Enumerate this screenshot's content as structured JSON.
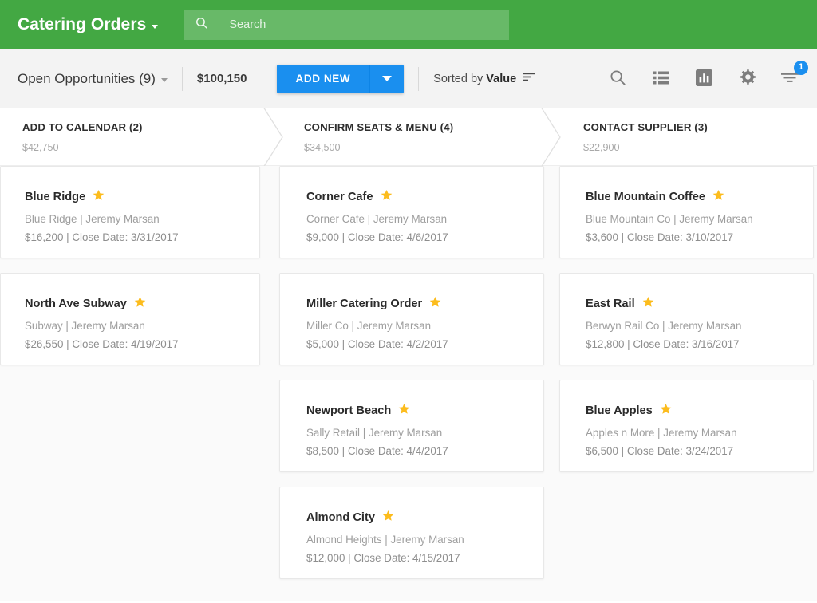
{
  "appbar": {
    "title": "Catering Orders",
    "title_caret_icon": "caret-down-icon",
    "search_icon": "search-icon",
    "search_placeholder": "Search",
    "search_value": "",
    "background_color": "#43a843"
  },
  "toolbar": {
    "scope_label": "Open Opportunities (9)",
    "scope_caret_icon": "caret-down-icon",
    "total_amount": "$100,150",
    "add_new_label": "ADD NEW",
    "add_new_caret_icon": "caret-down-icon",
    "add_new_color": "#1a8fef",
    "sorted_by_prefix": "Sorted by",
    "sorted_by_field": "Value",
    "sort_icon": "sort-descending-icon",
    "icons": [
      {
        "name": "search-icon",
        "label": "Search"
      },
      {
        "name": "list-view-icon",
        "label": "List view"
      },
      {
        "name": "chart-view-icon",
        "label": "Chart view"
      },
      {
        "name": "gear-icon",
        "label": "Settings"
      },
      {
        "name": "filter-icon",
        "label": "Filters"
      }
    ],
    "filter_badge_count": "1",
    "filter_badge_color": "#1a8fef",
    "background_color": "#f3f3f3"
  },
  "board": {
    "star_color": "#fcbc1d",
    "columns": [
      {
        "stage": "ADD TO CALENDAR (2)",
        "stage_value": "$42,750",
        "cards": [
          {
            "title": "Blue Ridge",
            "star_icon": "star-icon",
            "account": "Blue Ridge | Jeremy Marsan",
            "meta": "$16,200 | Close Date: 3/31/2017"
          },
          {
            "title": "North Ave Subway",
            "star_icon": "star-icon",
            "account": "Subway | Jeremy Marsan",
            "meta": "$26,550 | Close Date: 4/19/2017"
          }
        ]
      },
      {
        "stage": "CONFIRM SEATS & MENU (4)",
        "stage_value": "$34,500",
        "cards": [
          {
            "title": "Corner Cafe",
            "star_icon": "star-icon",
            "account": "Corner Cafe | Jeremy Marsan",
            "meta": "$9,000 | Close Date: 4/6/2017"
          },
          {
            "title": "Miller Catering Order",
            "star_icon": "star-icon",
            "account": "Miller Co | Jeremy Marsan",
            "meta": "$5,000 | Close Date: 4/2/2017"
          },
          {
            "title": "Newport Beach",
            "star_icon": "star-icon",
            "account": "Sally Retail | Jeremy Marsan",
            "meta": "$8,500 | Close Date: 4/4/2017"
          },
          {
            "title": "Almond City",
            "star_icon": "star-icon",
            "account": "Almond Heights | Jeremy Marsan",
            "meta": "$12,000 | Close Date: 4/15/2017"
          }
        ]
      },
      {
        "stage": "CONTACT SUPPLIER (3)",
        "stage_value": "$22,900",
        "cards": [
          {
            "title": "Blue Mountain Coffee",
            "star_icon": "star-icon",
            "account": "Blue Mountain Co | Jeremy Marsan",
            "meta": "$3,600 | Close Date: 3/10/2017"
          },
          {
            "title": "East Rail",
            "star_icon": "star-icon",
            "account": "Berwyn Rail Co | Jeremy Marsan",
            "meta": "$12,800 | Close Date: 3/16/2017"
          },
          {
            "title": "Blue Apples",
            "star_icon": "star-icon",
            "account": "Apples n More | Jeremy Marsan",
            "meta": "$6,500 | Close Date: 3/24/2017"
          }
        ]
      }
    ]
  }
}
